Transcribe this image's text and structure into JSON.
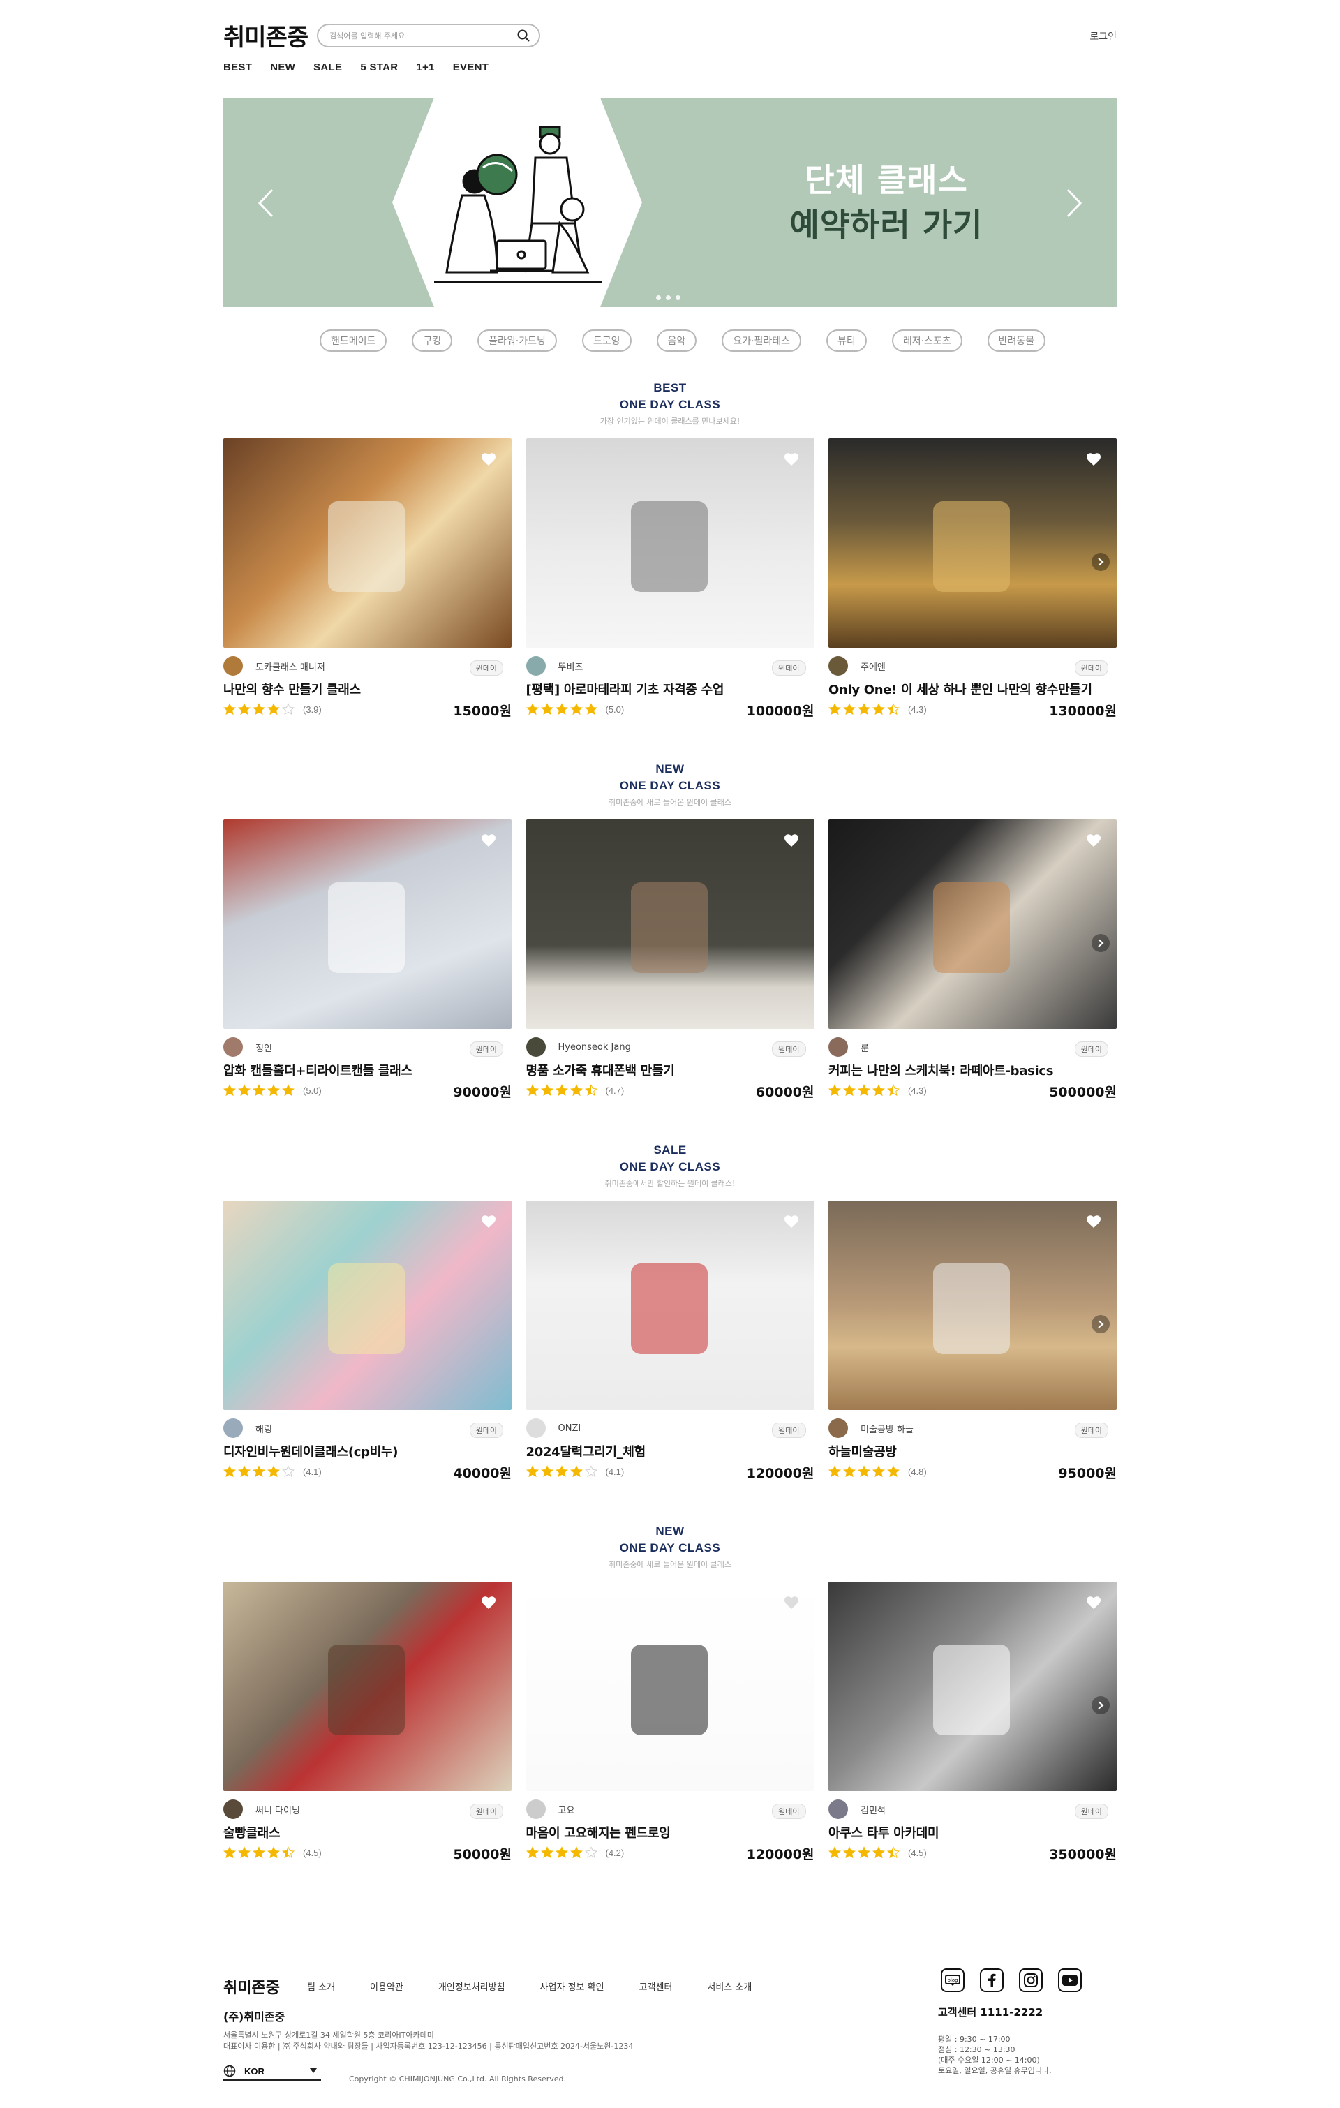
{
  "header": {
    "logo": "취미존중",
    "search_placeholder": "검색어를 입력해 주세요",
    "login": "로그인",
    "nav": [
      "BEST",
      "NEW",
      "SALE",
      "5 STAR",
      "1+1",
      "EVENT"
    ]
  },
  "banner": {
    "line1": "단체 클래스",
    "line2": "예약하러 가기",
    "slides": 3,
    "colors": {
      "bg": "#b3c9b8",
      "title_dark": "#2e4a38"
    }
  },
  "categories": [
    "핸드메이드",
    "쿠킹",
    "플라워·가드닝",
    "드로잉",
    "음악",
    "요가·필라테스",
    "뷰티",
    "레저·스포츠",
    "반려동물"
  ],
  "sections": [
    {
      "tag": "BEST",
      "title": "ONE DAY CLASS",
      "desc": "가장 인기있는 원데이 클래스를 만나보세요!",
      "cards": [
        {
          "seller": "모카클래스 매니저",
          "badge": "원데이",
          "name": "나만의 향수 만들기 클래스",
          "rating": 3.9,
          "rating_text": "(3.9)",
          "price": "15000원"
        },
        {
          "seller": "뚜비즈",
          "badge": "원데이",
          "name": "[평택] 아로마테라피 기초 자격증 수업",
          "rating": 5.0,
          "rating_text": "(5.0)",
          "price": "100000원"
        },
        {
          "seller": "주에엔",
          "badge": "원데이",
          "name": "Only One! 이 세상 하나 뿐인 나만의 향수만들기",
          "rating": 4.3,
          "rating_text": "(4.3)",
          "price": "130000원"
        }
      ]
    },
    {
      "tag": "NEW",
      "title": "ONE DAY CLASS",
      "desc": "취미존중에 새로 들어온 원데이 클래스",
      "cards": [
        {
          "seller": "정인",
          "badge": "원데이",
          "name": "압화 캔들홀더+티라이트캔들 클래스",
          "rating": 5.0,
          "rating_text": "(5.0)",
          "price": "90000원"
        },
        {
          "seller": "Hyeonseok Jang",
          "badge": "원데이",
          "name": "명품 소가죽 휴대폰백 만들기",
          "rating": 4.7,
          "rating_text": "(4.7)",
          "price": "60000원"
        },
        {
          "seller": "룬",
          "badge": "원데이",
          "name": "커피는 나만의 스케치북! 라떼아트-basics",
          "rating": 4.3,
          "rating_text": "(4.3)",
          "price": "500000원"
        }
      ]
    },
    {
      "tag": "SALE",
      "title": "ONE DAY CLASS",
      "desc": "취미존중에서만 할인하는 원데이 클래스!",
      "cards": [
        {
          "seller": "해링",
          "badge": "원데이",
          "name": "디자인비누원데이클래스(cp비누)",
          "rating": 4.1,
          "rating_text": "(4.1)",
          "price": "40000원"
        },
        {
          "seller": "ONZI",
          "badge": "원데이",
          "name": "2024달력그리기_체험",
          "rating": 4.1,
          "rating_text": "(4.1)",
          "price": "120000원"
        },
        {
          "seller": "미술공방 하늘",
          "badge": "원데이",
          "name": "하늘미술공방",
          "rating": 4.8,
          "rating_text": "(4.8)",
          "price": "95000원"
        }
      ]
    },
    {
      "tag": "NEW",
      "title": "ONE DAY CLASS",
      "desc": "취미존중에 새로 들어온 원데이 클래스",
      "cards": [
        {
          "seller": "써니 다이닝",
          "badge": "원데이",
          "name": "술빵클래스",
          "rating": 4.5,
          "rating_text": "(4.5)",
          "price": "50000원"
        },
        {
          "seller": "고요",
          "badge": "원데이",
          "name": "마음이 고요해지는 펜드로잉",
          "rating": 4.2,
          "rating_text": "(4.2)",
          "price": "120000원"
        },
        {
          "seller": "김민석",
          "badge": "원데이",
          "name": "아쿠스 타투 아카데미",
          "rating": 4.5,
          "rating_text": "(4.5)",
          "price": "350000원"
        }
      ]
    }
  ],
  "footer": {
    "logo": "취미존중",
    "links": [
      "팀 소개",
      "이용약관",
      "개인정보처리방침",
      "사업자 정보 확인",
      "고객센터",
      "서비스 소개"
    ],
    "company": "(주)취미존중",
    "address1": "서울특별시 노원구 상계로1길 34 세일학원 5층 코리아IT아카데미",
    "address2": "대표이사 이용한 | ㈜ 주식회사 약내와 팀장들 | 사업자등록번호 123-12-123456 | 통신판매업신고번호 2024-서울노원-1234",
    "center": "고객센터 1111-2222",
    "hours": [
      "평일 : 9:30 ~ 17:00",
      "점심 : 12:30 ~ 13:30",
      "(매주 수요일 12:00 ~ 14:00)",
      "토요일, 일요일, 공휴일 휴무입니다."
    ],
    "lang": "KOR",
    "copyright": "Copyright © CHIMIJONJUNG Co.,Ltd. All Rights Reserved."
  }
}
